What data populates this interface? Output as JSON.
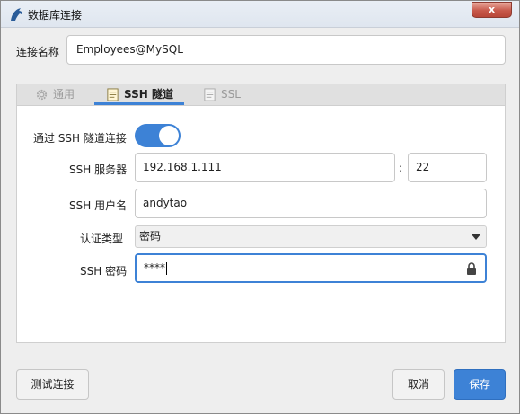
{
  "window": {
    "title": "数据库连接",
    "close_label": "x"
  },
  "connection": {
    "name_label": "连接名称",
    "name_value": "Employees@MySQL"
  },
  "tabs": [
    {
      "label": "通用",
      "icon": "gear-icon",
      "active": false
    },
    {
      "label": "SSH 隧道",
      "icon": "document-icon",
      "active": true
    },
    {
      "label": "SSL",
      "icon": "document-icon",
      "active": false
    }
  ],
  "ssh": {
    "enable_label": "通过 SSH 隧道连接",
    "enabled": true,
    "server_label": "SSH 服务器",
    "server_value": "192.168.1.111",
    "port_separator": ":",
    "port_value": "22",
    "user_label": "SSH 用户名",
    "user_value": "andytao",
    "auth_label": "认证类型",
    "auth_value": "密码",
    "password_label": "SSH 密码",
    "password_value": "****"
  },
  "buttons": {
    "test": "测试连接",
    "cancel": "取消",
    "save": "保存"
  },
  "colors": {
    "accent": "#3d82d6"
  }
}
